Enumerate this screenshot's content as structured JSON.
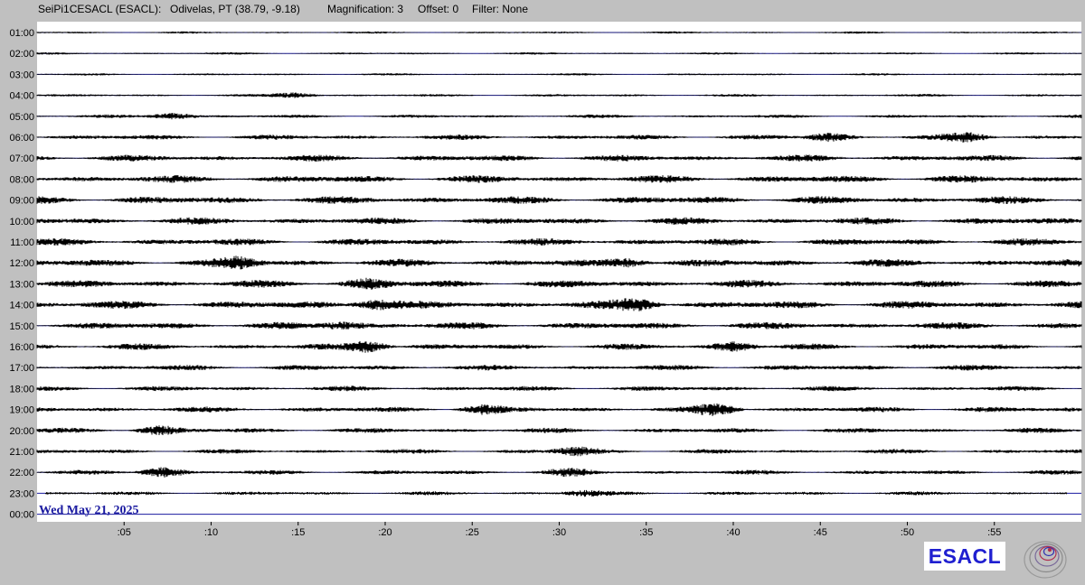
{
  "header": {
    "station": "SeiPi1CESACL (ESACL):",
    "location": "Odivelas, PT (38.79, -9.18)",
    "magnification": "Magnification: 3",
    "offset": "Offset: 0",
    "filter": "Filter: None"
  },
  "chart_data": {
    "type": "line",
    "title": "",
    "row_labels": [
      "01:00",
      "02:00",
      "03:00",
      "04:00",
      "05:00",
      "06:00",
      "07:00",
      "08:00",
      "09:00",
      "10:00",
      "11:00",
      "12:00",
      "13:00",
      "14:00",
      "15:00",
      "16:00",
      "17:00",
      "18:00",
      "19:00",
      "20:00",
      "21:00",
      "22:00",
      "23:00",
      "00:00"
    ],
    "x_ticks": [
      ":05",
      ":10",
      ":15",
      ":20",
      ":25",
      ":30",
      ":35",
      ":40",
      ":45",
      ":50",
      ":55"
    ],
    "x_tick_minutes": [
      5,
      10,
      15,
      20,
      25,
      30,
      35,
      40,
      45,
      50,
      55
    ],
    "xlim_minutes": [
      0,
      60
    ],
    "date": "Wed May 21, 2025",
    "trace_end_minute_row_23": 59.2,
    "trace_start_minute_row_23": 0.5,
    "colors": {
      "trace": "#000000",
      "baseline": "#1a1aa0",
      "plot_bg": "#ffffff",
      "frame_bg": "#c0c0c0"
    },
    "noise_amplitude_by_row": [
      1,
      1,
      1,
      1.2,
      1.5,
      2.2,
      2.8,
      3.2,
      3.3,
      3.0,
      3.0,
      3.2,
      3.2,
      3.4,
      3.0,
      2.6,
      2.4,
      2.2,
      2.4,
      2.2,
      2.0,
      2.0,
      1.6,
      0
    ],
    "events": [
      {
        "row": 4,
        "minute": 7.8,
        "strength": 2.5
      },
      {
        "row": 3,
        "minute": 14.8,
        "strength": 2.0
      },
      {
        "row": 5,
        "minute": 45.5,
        "strength": 2.5
      },
      {
        "row": 5,
        "minute": 53.5,
        "strength": 3.0
      },
      {
        "row": 11,
        "minute": 11.5,
        "strength": 3.5
      },
      {
        "row": 11,
        "minute": 34.0,
        "strength": 3.0
      },
      {
        "row": 12,
        "minute": 19.0,
        "strength": 3.0
      },
      {
        "row": 13,
        "minute": 19.5,
        "strength": 4.0
      },
      {
        "row": 13,
        "minute": 34.5,
        "strength": 4.0
      },
      {
        "row": 14,
        "minute": 17.5,
        "strength": 2.5
      },
      {
        "row": 15,
        "minute": 19.0,
        "strength": 4.5
      },
      {
        "row": 15,
        "minute": 40.0,
        "strength": 3.0
      },
      {
        "row": 18,
        "minute": 39.0,
        "strength": 4.0
      },
      {
        "row": 18,
        "minute": 25.5,
        "strength": 3.0
      },
      {
        "row": 19,
        "minute": 7.0,
        "strength": 3.0
      },
      {
        "row": 20,
        "minute": 31.0,
        "strength": 3.0
      },
      {
        "row": 21,
        "minute": 7.2,
        "strength": 3.5
      },
      {
        "row": 21,
        "minute": 30.5,
        "strength": 2.0
      },
      {
        "row": 22,
        "minute": 31.5,
        "strength": 2.0
      }
    ]
  },
  "logo": {
    "text": "ESACL",
    "emblem_icon": "spiral-emblem-icon"
  }
}
